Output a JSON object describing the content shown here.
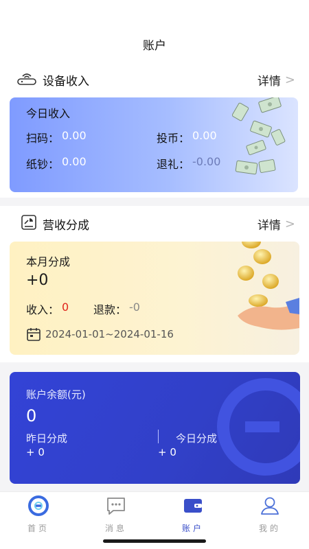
{
  "header": {
    "title": "账户"
  },
  "device_income": {
    "title": "设备收入",
    "detail_label": "详情",
    "card": {
      "title": "今日收入",
      "scan_label": "扫码：",
      "scan_value": "0.00",
      "coin_label": "投币：",
      "coin_value": "0.00",
      "cash_label": "纸钞：",
      "cash_value": "0.00",
      "refund_label": "退礼：",
      "refund_value": "-0.00"
    }
  },
  "revenue_share": {
    "title": "营收分成",
    "detail_label": "详情",
    "card": {
      "title": "本月分成",
      "amount": "+0",
      "income_label": "收入：",
      "income_value": "0",
      "refund_label": "退款：",
      "refund_value": "-0",
      "date_range": "2024-01-01~2024-01-16"
    }
  },
  "balance": {
    "title": "账户余额(元)",
    "amount": "0",
    "yesterday_label": "昨日分成",
    "yesterday_value": "+ 0",
    "today_label": "今日分成",
    "today_value": "+ 0"
  },
  "tabbar": {
    "items": [
      {
        "label": "首页",
        "icon": "home-logo-icon",
        "active": false
      },
      {
        "label": "消息",
        "icon": "message-icon",
        "active": false
      },
      {
        "label": "账户",
        "icon": "wallet-icon",
        "active": true
      },
      {
        "label": "我的",
        "icon": "user-icon",
        "active": false
      }
    ]
  },
  "colors": {
    "accent": "#3a4fc9",
    "income_red": "#e0251c",
    "card_blue": "#8aa4ff",
    "card_dark": "#3343d6"
  }
}
